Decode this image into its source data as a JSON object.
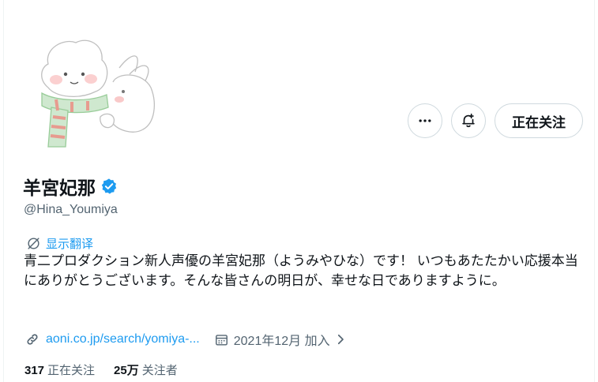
{
  "profile": {
    "display_name": "羊宮妃那",
    "handle": "@Hina_Youmiya",
    "verified": true,
    "translate_label": "显示翻译",
    "bio": "青二プロダクション新人声優の羊宮妃那（ようみやひな）です！ いつもあたたかい応援本当にありがとうございます。そんな皆さんの明日が、幸せな日でありますように。",
    "website": "aoni.co.jp/search/yomiya-...",
    "joined": "2021年12月 加入",
    "following_count": "317",
    "following_label": "正在关注",
    "followers_count": "25万",
    "followers_label": "关注者"
  },
  "actions": {
    "more_icon": "more-horizontal-icon",
    "notify_icon": "bell-icon",
    "follow_label": "正在关注"
  },
  "colors": {
    "accent": "#1d9bf0",
    "secondary_text": "#536471",
    "border": "#cfd9de",
    "verified": "#1d9bf0"
  }
}
